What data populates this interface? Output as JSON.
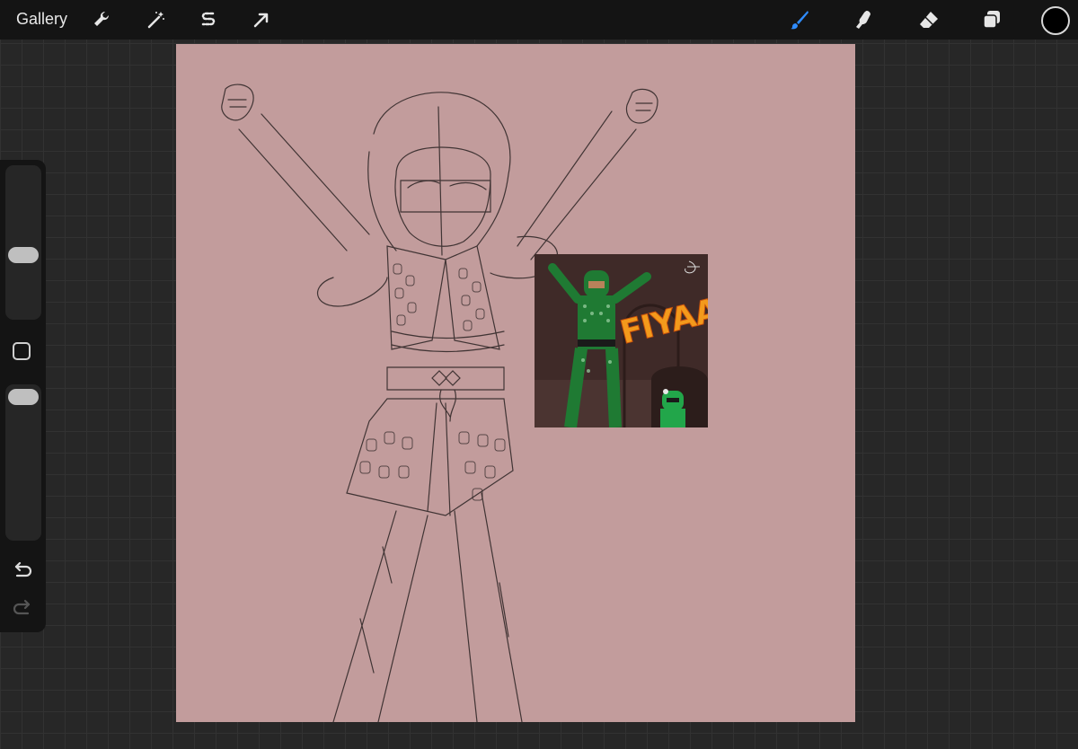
{
  "topbar": {
    "gallery_label": "Gallery",
    "left_tools": [
      {
        "name": "actions",
        "icon": "wrench-icon"
      },
      {
        "name": "adjustments",
        "icon": "magic-wand-icon"
      },
      {
        "name": "selection",
        "icon": "selection-s-icon"
      },
      {
        "name": "transform",
        "icon": "arrow-cursor-icon"
      }
    ],
    "right_tools": [
      {
        "name": "brush",
        "icon": "brush-icon",
        "active": true,
        "color": "#2f8cff"
      },
      {
        "name": "smudge",
        "icon": "smudge-finger-icon"
      },
      {
        "name": "eraser",
        "icon": "eraser-icon"
      },
      {
        "name": "layers",
        "icon": "layers-icon"
      }
    ],
    "current_color": "#000000"
  },
  "sidebar": {
    "brush_size_level": 0.5,
    "opacity_level": 0.05,
    "modifier": "modify-button",
    "undo": "undo-icon",
    "redo": "redo-icon"
  },
  "canvas": {
    "background_color": "#c29c9c",
    "reference_image": {
      "caption_text": "FIYAAAH",
      "background_color": "#3f2a28",
      "accent_color": "#f39a1c"
    }
  }
}
